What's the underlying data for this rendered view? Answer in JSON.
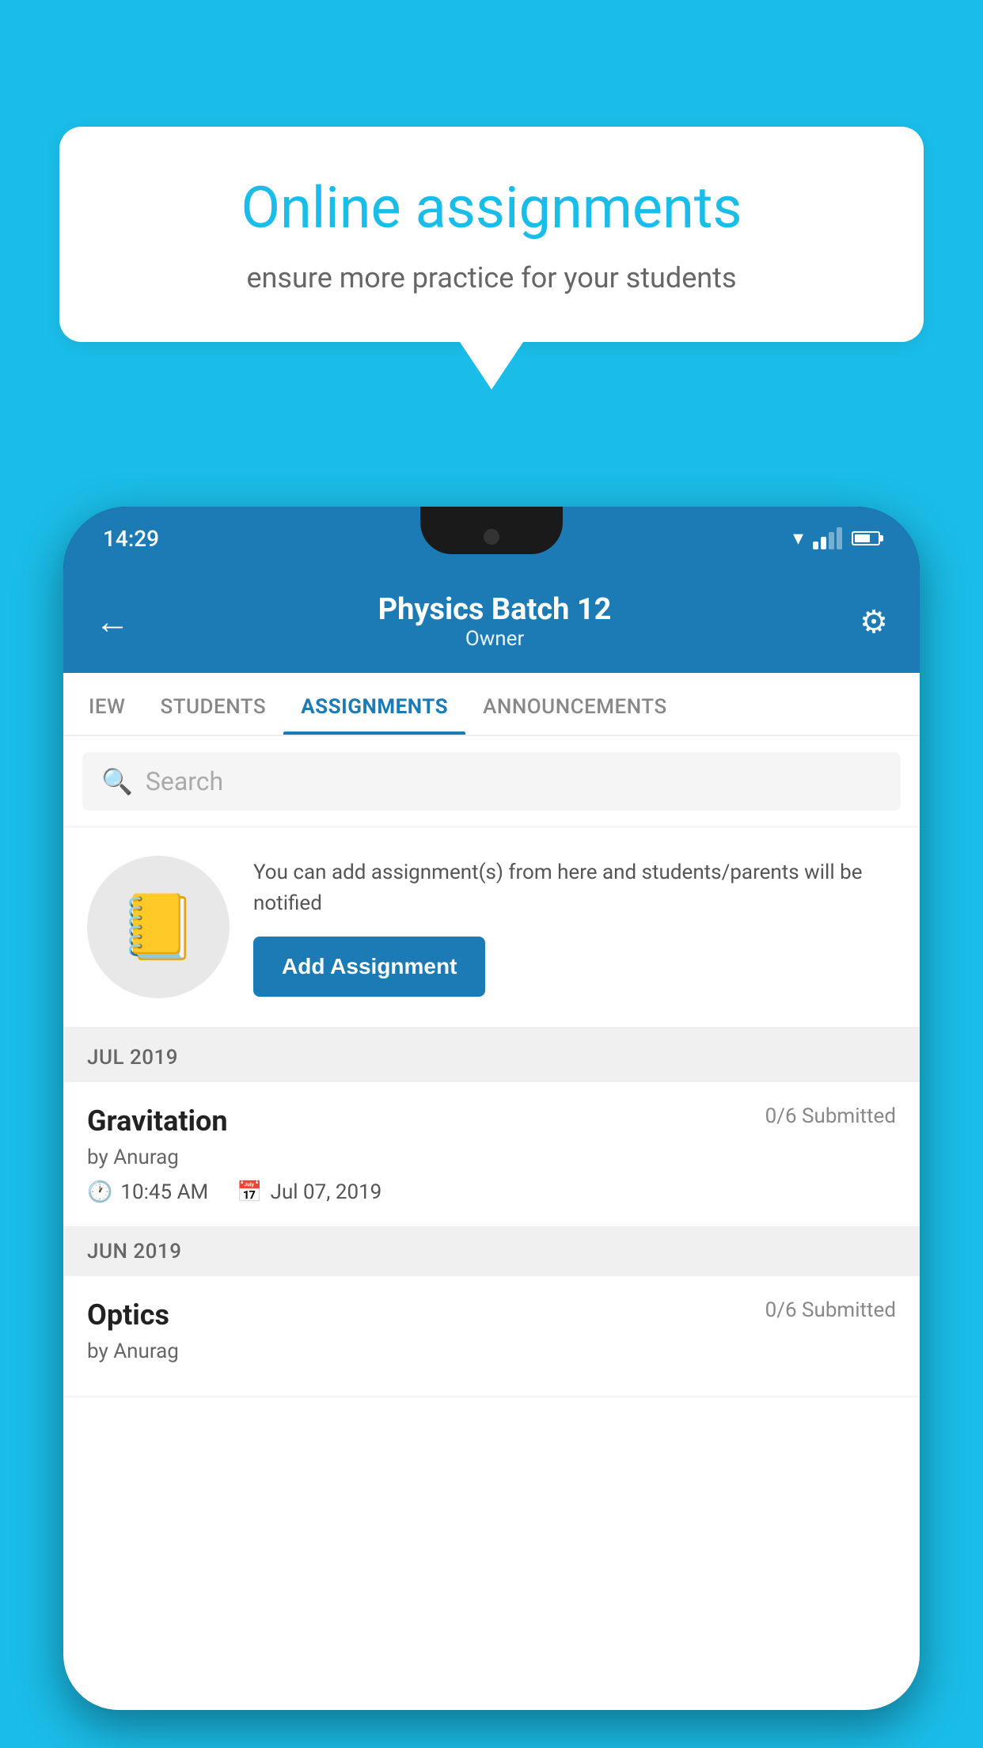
{
  "background_color": "#1ABDE8",
  "speech_bubble": {
    "title": "Online assignments",
    "subtitle": "ensure more practice for your students"
  },
  "phone": {
    "status_bar": {
      "time": "14:29"
    },
    "header": {
      "title": "Physics Batch 12",
      "subtitle": "Owner",
      "back_label": "←",
      "settings_label": "⚙"
    },
    "tabs": [
      {
        "label": "IEW",
        "active": false
      },
      {
        "label": "STUDENTS",
        "active": false
      },
      {
        "label": "ASSIGNMENTS",
        "active": true
      },
      {
        "label": "ANNOUNCEMENTS",
        "active": false
      }
    ],
    "search": {
      "placeholder": "Search"
    },
    "promo": {
      "text": "You can add assignment(s) from here and students/parents will be notified",
      "button_label": "Add Assignment"
    },
    "sections": [
      {
        "month_label": "JUL 2019",
        "assignments": [
          {
            "name": "Gravitation",
            "submitted": "0/6 Submitted",
            "author": "by Anurag",
            "time": "10:45 AM",
            "date": "Jul 07, 2019"
          }
        ]
      },
      {
        "month_label": "JUN 2019",
        "assignments": [
          {
            "name": "Optics",
            "submitted": "0/6 Submitted",
            "author": "by Anurag",
            "time": "",
            "date": ""
          }
        ]
      }
    ]
  }
}
